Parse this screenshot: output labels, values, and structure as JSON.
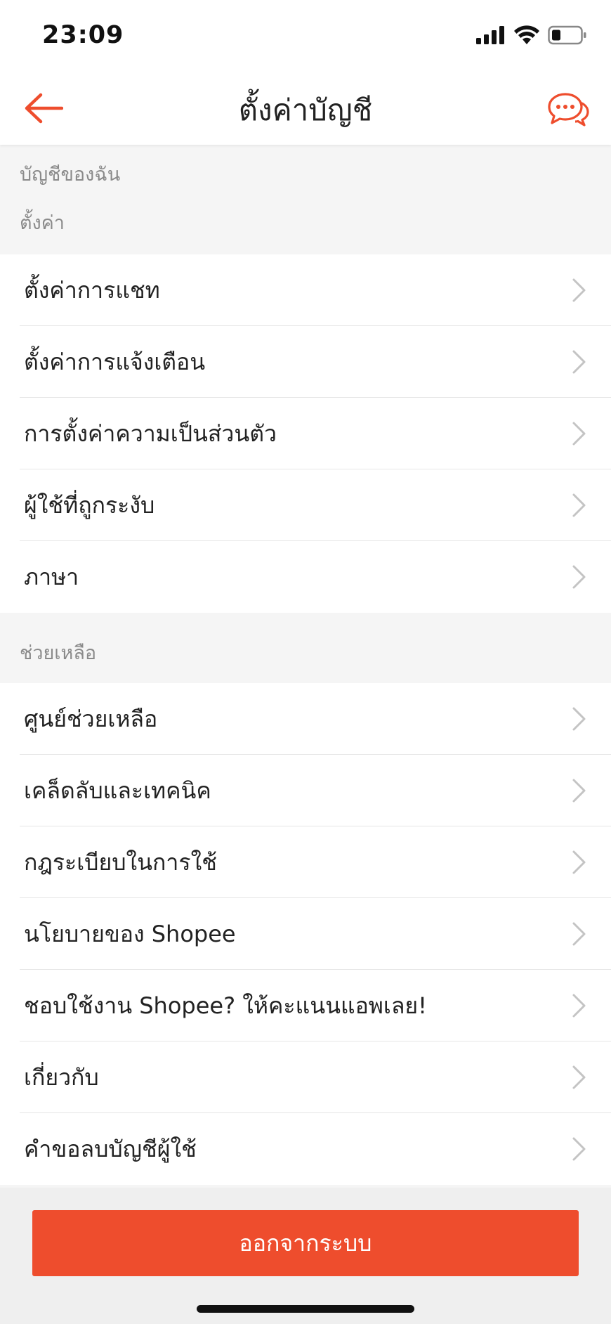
{
  "status_bar": {
    "time": "23:09",
    "icons": [
      "cellular-signal-icon",
      "wifi-icon",
      "battery-icon"
    ]
  },
  "header": {
    "back_icon": "arrow-left-icon",
    "title": "ตั้งค่าบัญชี",
    "chat_icon": "chat-bubbles-icon"
  },
  "sections": [
    {
      "title": "บัญชีของฉัน",
      "items": []
    },
    {
      "title": "ตั้งค่า",
      "items": [
        {
          "label": "ตั้งค่าการแชท"
        },
        {
          "label": "ตั้งค่าการแจ้งเตือน"
        },
        {
          "label": "การตั้งค่าความเป็นส่วนตัว"
        },
        {
          "label": "ผู้ใช้ที่ถูกระงับ"
        },
        {
          "label": "ภาษา"
        }
      ]
    },
    {
      "title": "ช่วยเหลือ",
      "items": [
        {
          "label": "ศูนย์ช่วยเหลือ"
        },
        {
          "label": "เคล็ดลับและเทคนิค"
        },
        {
          "label": "กฎระเบียบในการใช้"
        },
        {
          "label": "นโยบายของ Shopee"
        },
        {
          "label": "ชอบใช้งาน Shopee? ให้คะแนนแอพเลย!"
        },
        {
          "label": "เกี่ยวกับ"
        },
        {
          "label": "คำขอลบบัญชีผู้ใช้"
        }
      ]
    }
  ],
  "logout_label": "ออกจากระบบ",
  "colors": {
    "accent": "#ee4d2d",
    "background": "#f5f5f5",
    "chevron": "#c4c4c4"
  }
}
